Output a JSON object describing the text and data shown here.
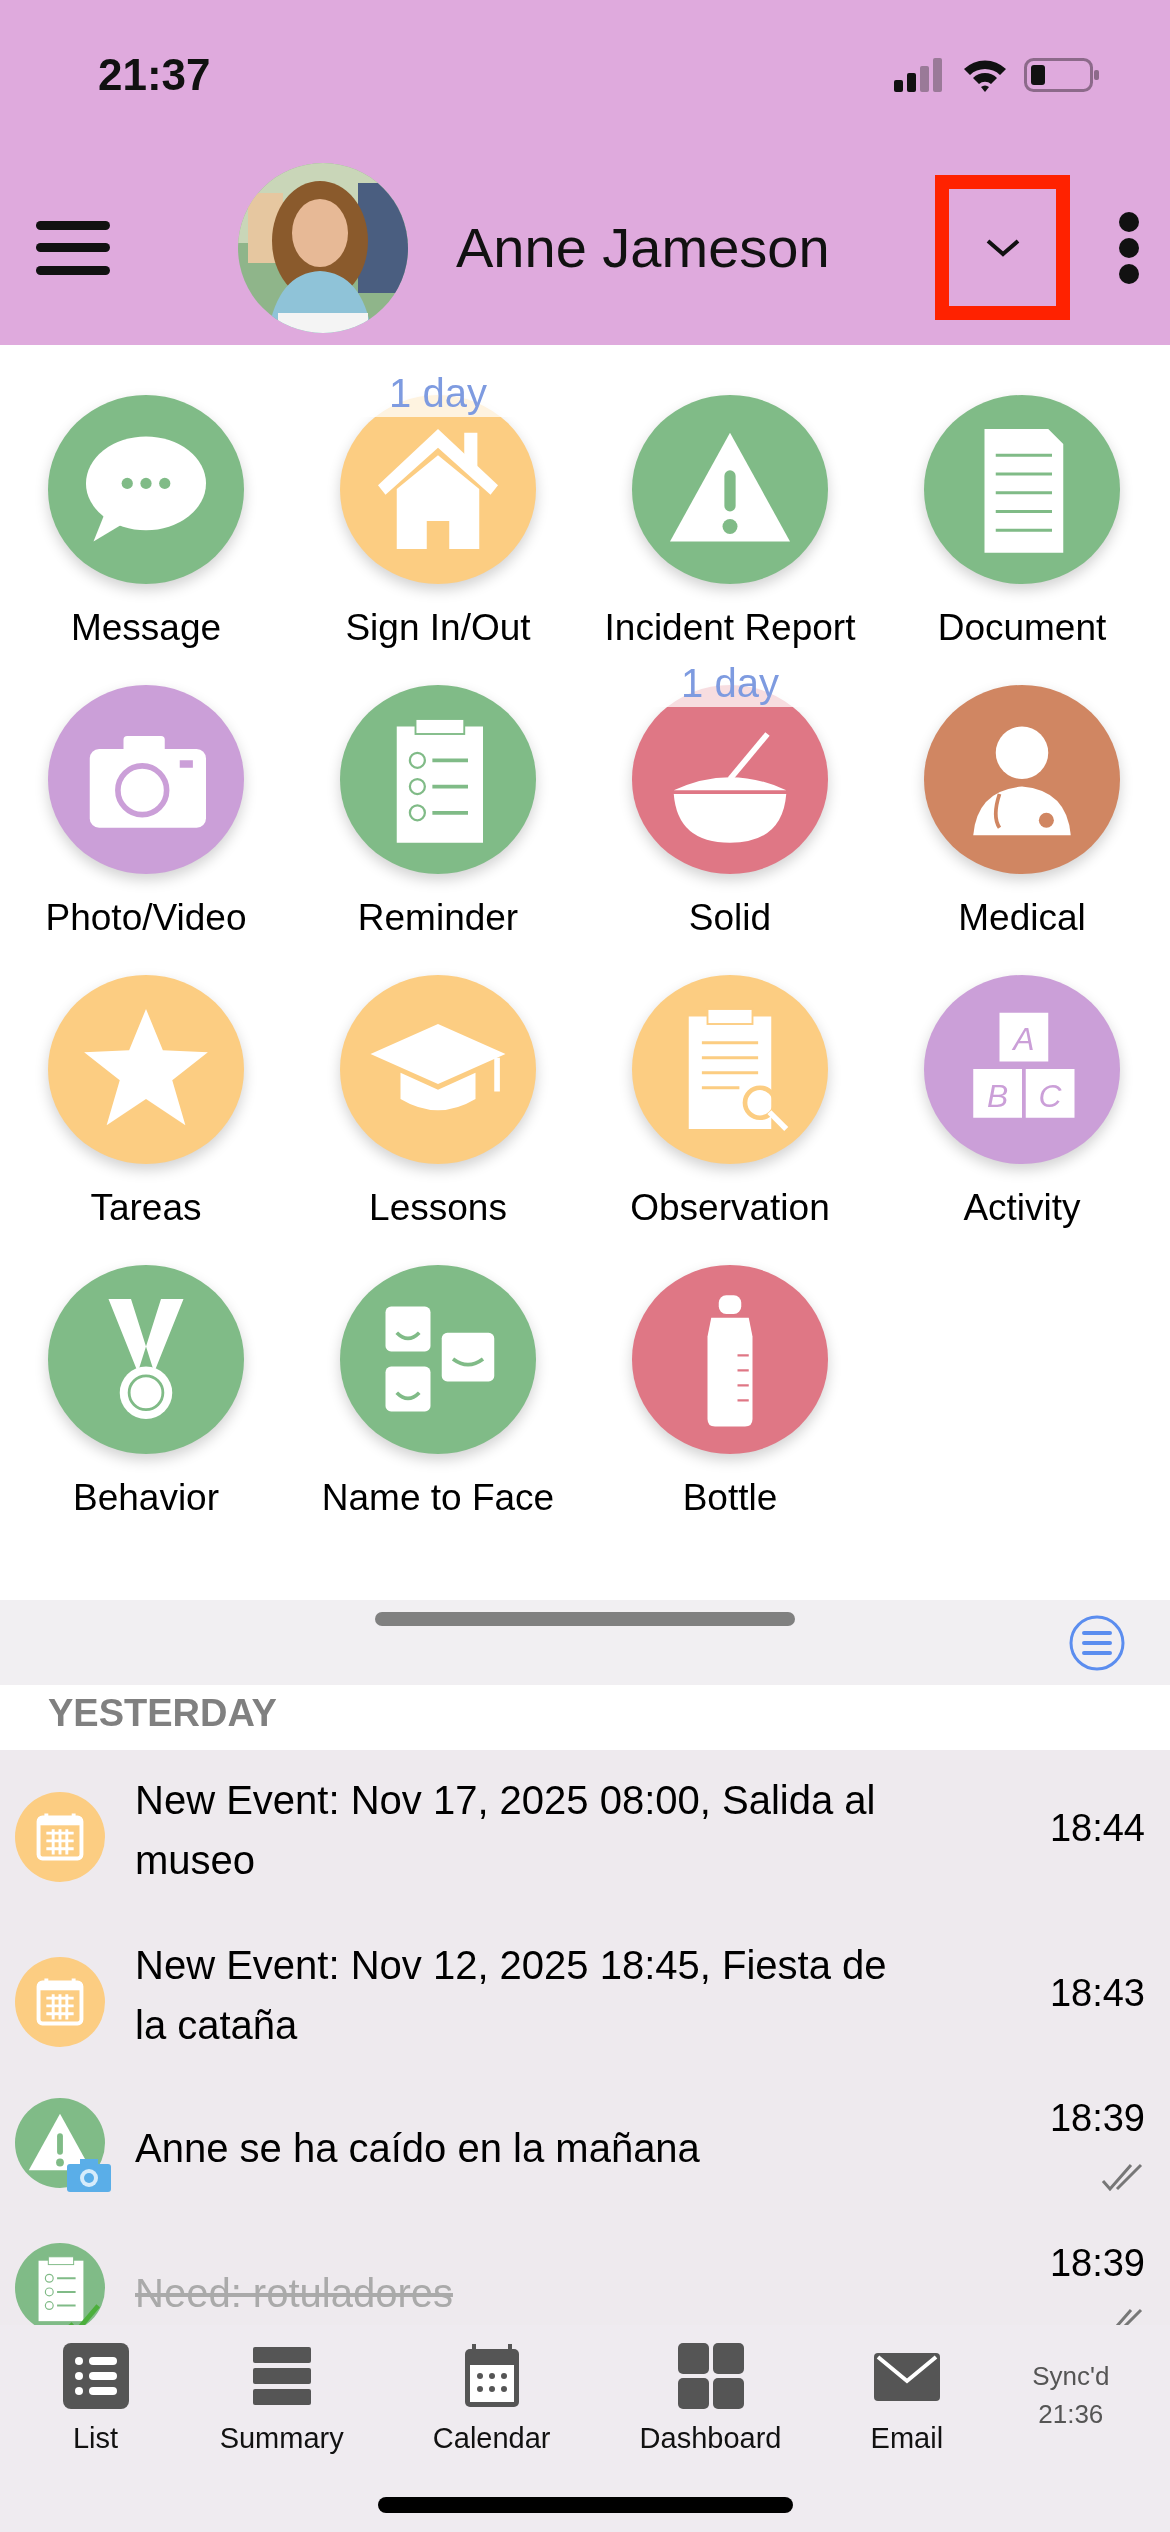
{
  "status_bar": {
    "time": "21:37"
  },
  "header": {
    "child_name": "Anne Jameson",
    "dropdown_highlighted": true
  },
  "tiles": [
    {
      "label": "Message",
      "kind": "message",
      "color": "#80bb87"
    },
    {
      "label": "Sign In/Out",
      "kind": "home",
      "color": "#fccd82",
      "note": "1 day"
    },
    {
      "label": "Incident Report",
      "kind": "warning",
      "color": "#80bb87"
    },
    {
      "label": "Document",
      "kind": "document",
      "color": "#80bb87"
    },
    {
      "label": "Photo/Video",
      "kind": "camera",
      "color": "#cb9fd8"
    },
    {
      "label": "Reminder",
      "kind": "checklist",
      "color": "#80bb87"
    },
    {
      "label": "Solid",
      "kind": "bowl",
      "color": "#df7785",
      "note": "1 day"
    },
    {
      "label": "Medical",
      "kind": "doctor",
      "color": "#d08662"
    },
    {
      "label": "Tareas",
      "kind": "star",
      "color": "#fccd82"
    },
    {
      "label": "Lessons",
      "kind": "cap",
      "color": "#fccd82"
    },
    {
      "label": "Observation",
      "kind": "clipboard",
      "color": "#fccd82"
    },
    {
      "label": "Activity",
      "kind": "blocks",
      "color": "#cb9fd8",
      "glyphs": [
        "A",
        "B",
        "C"
      ]
    },
    {
      "label": "Behavior",
      "kind": "medal",
      "color": "#80bb87"
    },
    {
      "label": "Name to Face",
      "kind": "faces",
      "color": "#80bb87"
    },
    {
      "label": "Bottle",
      "kind": "bottle",
      "color": "#df7785"
    }
  ],
  "feed": {
    "section": "YESTERDAY",
    "items": [
      {
        "kind": "event",
        "text": "New Event: Nov 17, 2025 08:00, Salida al museo",
        "time": "18:44",
        "read": false,
        "struck": false
      },
      {
        "kind": "event",
        "text": "New Event: Nov 12, 2025 18:45, Fiesta de la cataña",
        "time": "18:43",
        "read": false,
        "struck": false
      },
      {
        "kind": "incident",
        "text": "Anne se ha caído en la mañana",
        "time": "18:39",
        "read": true,
        "struck": false,
        "photo": true
      },
      {
        "kind": "reminder",
        "text": "Need: rotuladores",
        "time": "18:39",
        "read": true,
        "struck": true,
        "done": true
      }
    ]
  },
  "bottom_nav": [
    {
      "label": "List",
      "kind": "list"
    },
    {
      "label": "Summary",
      "kind": "summary"
    },
    {
      "label": "Calendar",
      "kind": "calendar"
    },
    {
      "label": "Dashboard",
      "kind": "dashboard"
    },
    {
      "label": "Email",
      "kind": "email"
    }
  ],
  "sync": {
    "line1": "Sync'd",
    "line2": "21:36"
  }
}
